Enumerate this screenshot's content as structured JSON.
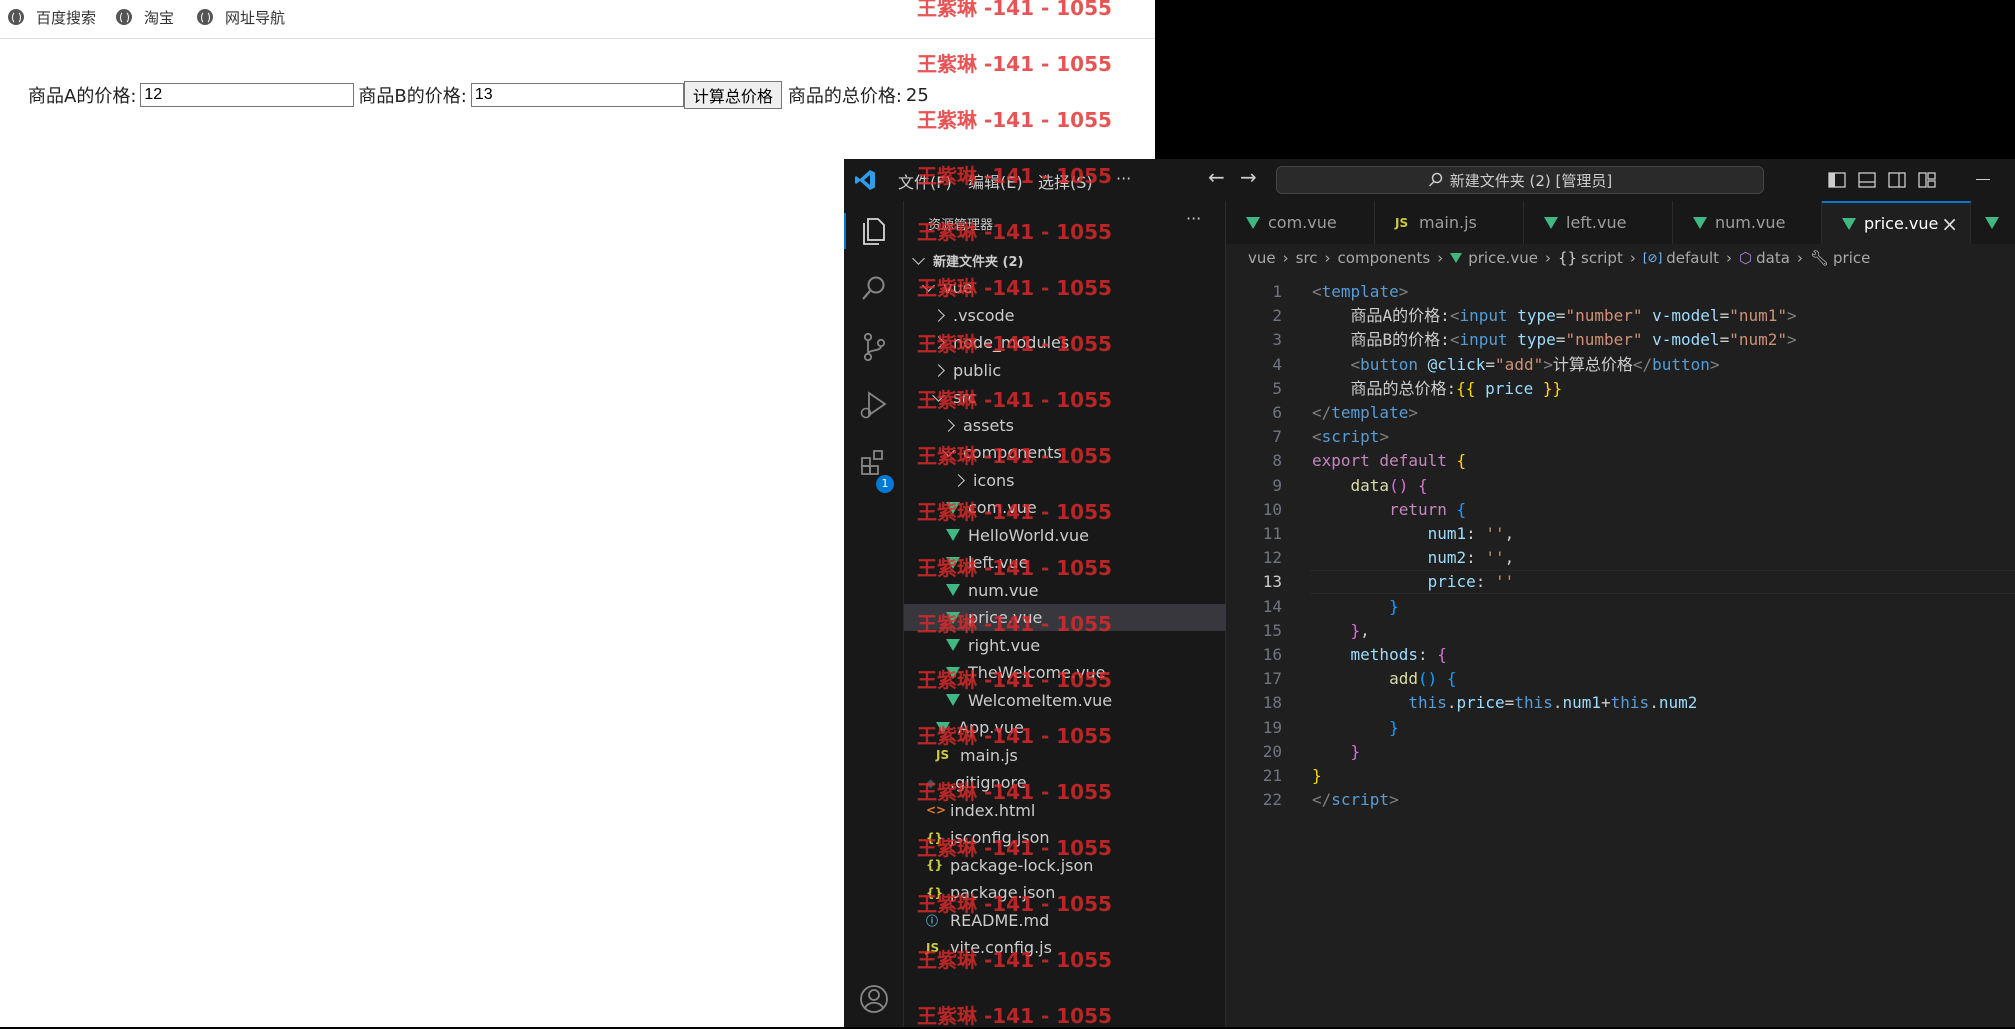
{
  "browser": {
    "bookmarks": [
      {
        "label": "百度搜索",
        "icon": "globe-icon"
      },
      {
        "label": "淘宝",
        "icon": "globe-icon"
      },
      {
        "label": "网址导航",
        "icon": "globe-icon"
      }
    ],
    "form": {
      "label_a": "商品A的价格:",
      "value_a": "12",
      "label_b": "商品B的价格:",
      "value_b": "13",
      "button": "计算总价格",
      "total_label": "商品的总价格:",
      "total_value": "25"
    }
  },
  "vscode": {
    "menu": [
      "文件(F)",
      "编辑(E)",
      "选择(S)",
      "···"
    ],
    "command_center": "新建文件夹 (2) [管理员]",
    "extensions_badge": "1",
    "explorer": {
      "title": "资源管理器",
      "more": "···",
      "root": "新建文件夹 (2)",
      "items": [
        {
          "label": "vue",
          "type": "folder-open"
        },
        {
          "label": ".vscode",
          "type": "folder"
        },
        {
          "label": "node_modules",
          "type": "folder"
        },
        {
          "label": "public",
          "type": "folder"
        },
        {
          "label": "src",
          "type": "folder-open"
        },
        {
          "label": "assets",
          "type": "folder"
        },
        {
          "label": "components",
          "type": "folder-open"
        },
        {
          "label": "icons",
          "type": "folder"
        },
        {
          "label": "com.vue",
          "type": "vue"
        },
        {
          "label": "HelloWorld.vue",
          "type": "vue"
        },
        {
          "label": "left.vue",
          "type": "vue"
        },
        {
          "label": "num.vue",
          "type": "vue"
        },
        {
          "label": "price.vue",
          "type": "vue",
          "selected": true
        },
        {
          "label": "right.vue",
          "type": "vue"
        },
        {
          "label": "TheWelcome.vue",
          "type": "vue"
        },
        {
          "label": "WelcomeItem.vue",
          "type": "vue"
        },
        {
          "label": "App.vue",
          "type": "vue"
        },
        {
          "label": "main.js",
          "type": "js"
        },
        {
          "label": ".gitignore",
          "type": "git"
        },
        {
          "label": "index.html",
          "type": "html"
        },
        {
          "label": "jsconfig.json",
          "type": "json"
        },
        {
          "label": "package-lock.json",
          "type": "json"
        },
        {
          "label": "package.json",
          "type": "json"
        },
        {
          "label": "README.md",
          "type": "info"
        },
        {
          "label": "vite.config.js",
          "type": "js"
        }
      ]
    },
    "tabs": [
      {
        "label": "com.vue",
        "type": "vue"
      },
      {
        "label": "main.js",
        "type": "js"
      },
      {
        "label": "left.vue",
        "type": "vue"
      },
      {
        "label": "num.vue",
        "type": "vue"
      },
      {
        "label": "price.vue",
        "type": "vue",
        "active": true
      }
    ],
    "breadcrumbs": [
      "vue",
      "src",
      "components",
      "price.vue",
      "script",
      "default",
      "data",
      "price"
    ],
    "code_lines": [
      [
        [
          "<",
          "#808080"
        ],
        [
          "template",
          "#569cd6"
        ],
        [
          ">",
          "#808080"
        ]
      ],
      [
        [
          "    商品A的价格:",
          "#cccccc"
        ],
        [
          "<",
          "#808080"
        ],
        [
          "input",
          "#569cd6"
        ],
        [
          " type",
          "#9cdcfe"
        ],
        [
          "=",
          "#cccccc"
        ],
        [
          "\"number\"",
          "#ce9178"
        ],
        [
          " v-model",
          "#9cdcfe"
        ],
        [
          "=",
          "#cccccc"
        ],
        [
          "\"num1\"",
          "#ce9178"
        ],
        [
          ">",
          "#808080"
        ]
      ],
      [
        [
          "    商品B的价格:",
          "#cccccc"
        ],
        [
          "<",
          "#808080"
        ],
        [
          "input",
          "#569cd6"
        ],
        [
          " type",
          "#9cdcfe"
        ],
        [
          "=",
          "#cccccc"
        ],
        [
          "\"number\"",
          "#ce9178"
        ],
        [
          " v-model",
          "#9cdcfe"
        ],
        [
          "=",
          "#cccccc"
        ],
        [
          "\"num2\"",
          "#ce9178"
        ],
        [
          ">",
          "#808080"
        ]
      ],
      [
        [
          "    <",
          "#808080"
        ],
        [
          "button",
          "#569cd6"
        ],
        [
          " @click",
          "#9cdcfe"
        ],
        [
          "=",
          "#cccccc"
        ],
        [
          "\"add\"",
          "#ce9178"
        ],
        [
          ">",
          "#808080"
        ],
        [
          "计算总价格",
          "#cccccc"
        ],
        [
          "</",
          "#808080"
        ],
        [
          "button",
          "#569cd6"
        ],
        [
          ">",
          "#808080"
        ]
      ],
      [
        [
          "    商品的总价格:",
          "#cccccc"
        ],
        [
          "{{",
          "#ffd700"
        ],
        [
          " price ",
          "#9cdcfe"
        ],
        [
          "}}",
          "#ffd700"
        ]
      ],
      [
        [
          "</",
          "#808080"
        ],
        [
          "template",
          "#569cd6"
        ],
        [
          ">",
          "#808080"
        ]
      ],
      [
        [
          "<",
          "#808080"
        ],
        [
          "script",
          "#569cd6"
        ],
        [
          ">",
          "#808080"
        ]
      ],
      [
        [
          "export default ",
          "#c586c0"
        ],
        [
          "{",
          "#ffd700"
        ]
      ],
      [
        [
          "    ",
          "#cccccc"
        ],
        [
          "data",
          "#dcdcaa"
        ],
        [
          "()",
          "#da70d6"
        ],
        [
          " {",
          "#da70d6"
        ]
      ],
      [
        [
          "        ",
          "#cccccc"
        ],
        [
          "return",
          "#c586c0"
        ],
        [
          " {",
          "#179fff"
        ]
      ],
      [
        [
          "            num1",
          "#9cdcfe"
        ],
        [
          ": ",
          "#cccccc"
        ],
        [
          "''",
          "#ce9178"
        ],
        [
          ",",
          "#cccccc"
        ]
      ],
      [
        [
          "            num2",
          "#9cdcfe"
        ],
        [
          ": ",
          "#cccccc"
        ],
        [
          "''",
          "#ce9178"
        ],
        [
          ",",
          "#cccccc"
        ]
      ],
      [
        [
          "            price",
          "#9cdcfe"
        ],
        [
          ": ",
          "#cccccc"
        ],
        [
          "''",
          "#ce9178"
        ]
      ],
      [
        [
          "        }",
          "#179fff"
        ]
      ],
      [
        [
          "    }",
          "#da70d6"
        ],
        [
          ",",
          "#cccccc"
        ]
      ],
      [
        [
          "    methods",
          "#9cdcfe"
        ],
        [
          ": ",
          "#cccccc"
        ],
        [
          "{",
          "#da70d6"
        ]
      ],
      [
        [
          "        ",
          "#cccccc"
        ],
        [
          "add",
          "#dcdcaa"
        ],
        [
          "()",
          "#179fff"
        ],
        [
          " {",
          "#179fff"
        ]
      ],
      [
        [
          "          ",
          "#cccccc"
        ],
        [
          "this",
          "#569cd6"
        ],
        [
          ".",
          "#cccccc"
        ],
        [
          "price",
          "#9cdcfe"
        ],
        [
          "=",
          "#cccccc"
        ],
        [
          "this",
          "#569cd6"
        ],
        [
          ".",
          "#cccccc"
        ],
        [
          "num1",
          "#9cdcfe"
        ],
        [
          "+",
          "#cccccc"
        ],
        [
          "this",
          "#569cd6"
        ],
        [
          ".",
          "#cccccc"
        ],
        [
          "num2",
          "#9cdcfe"
        ]
      ],
      [
        [
          "        }",
          "#179fff"
        ]
      ],
      [
        [
          "    }",
          "#da70d6"
        ]
      ],
      [
        [
          "}",
          "#ffd700"
        ]
      ],
      [
        [
          "</",
          "#808080"
        ],
        [
          "script",
          "#569cd6"
        ],
        [
          ">",
          "#808080"
        ]
      ]
    ],
    "current_line": 13
  },
  "watermark": "王紫琳 -141 - 1055"
}
